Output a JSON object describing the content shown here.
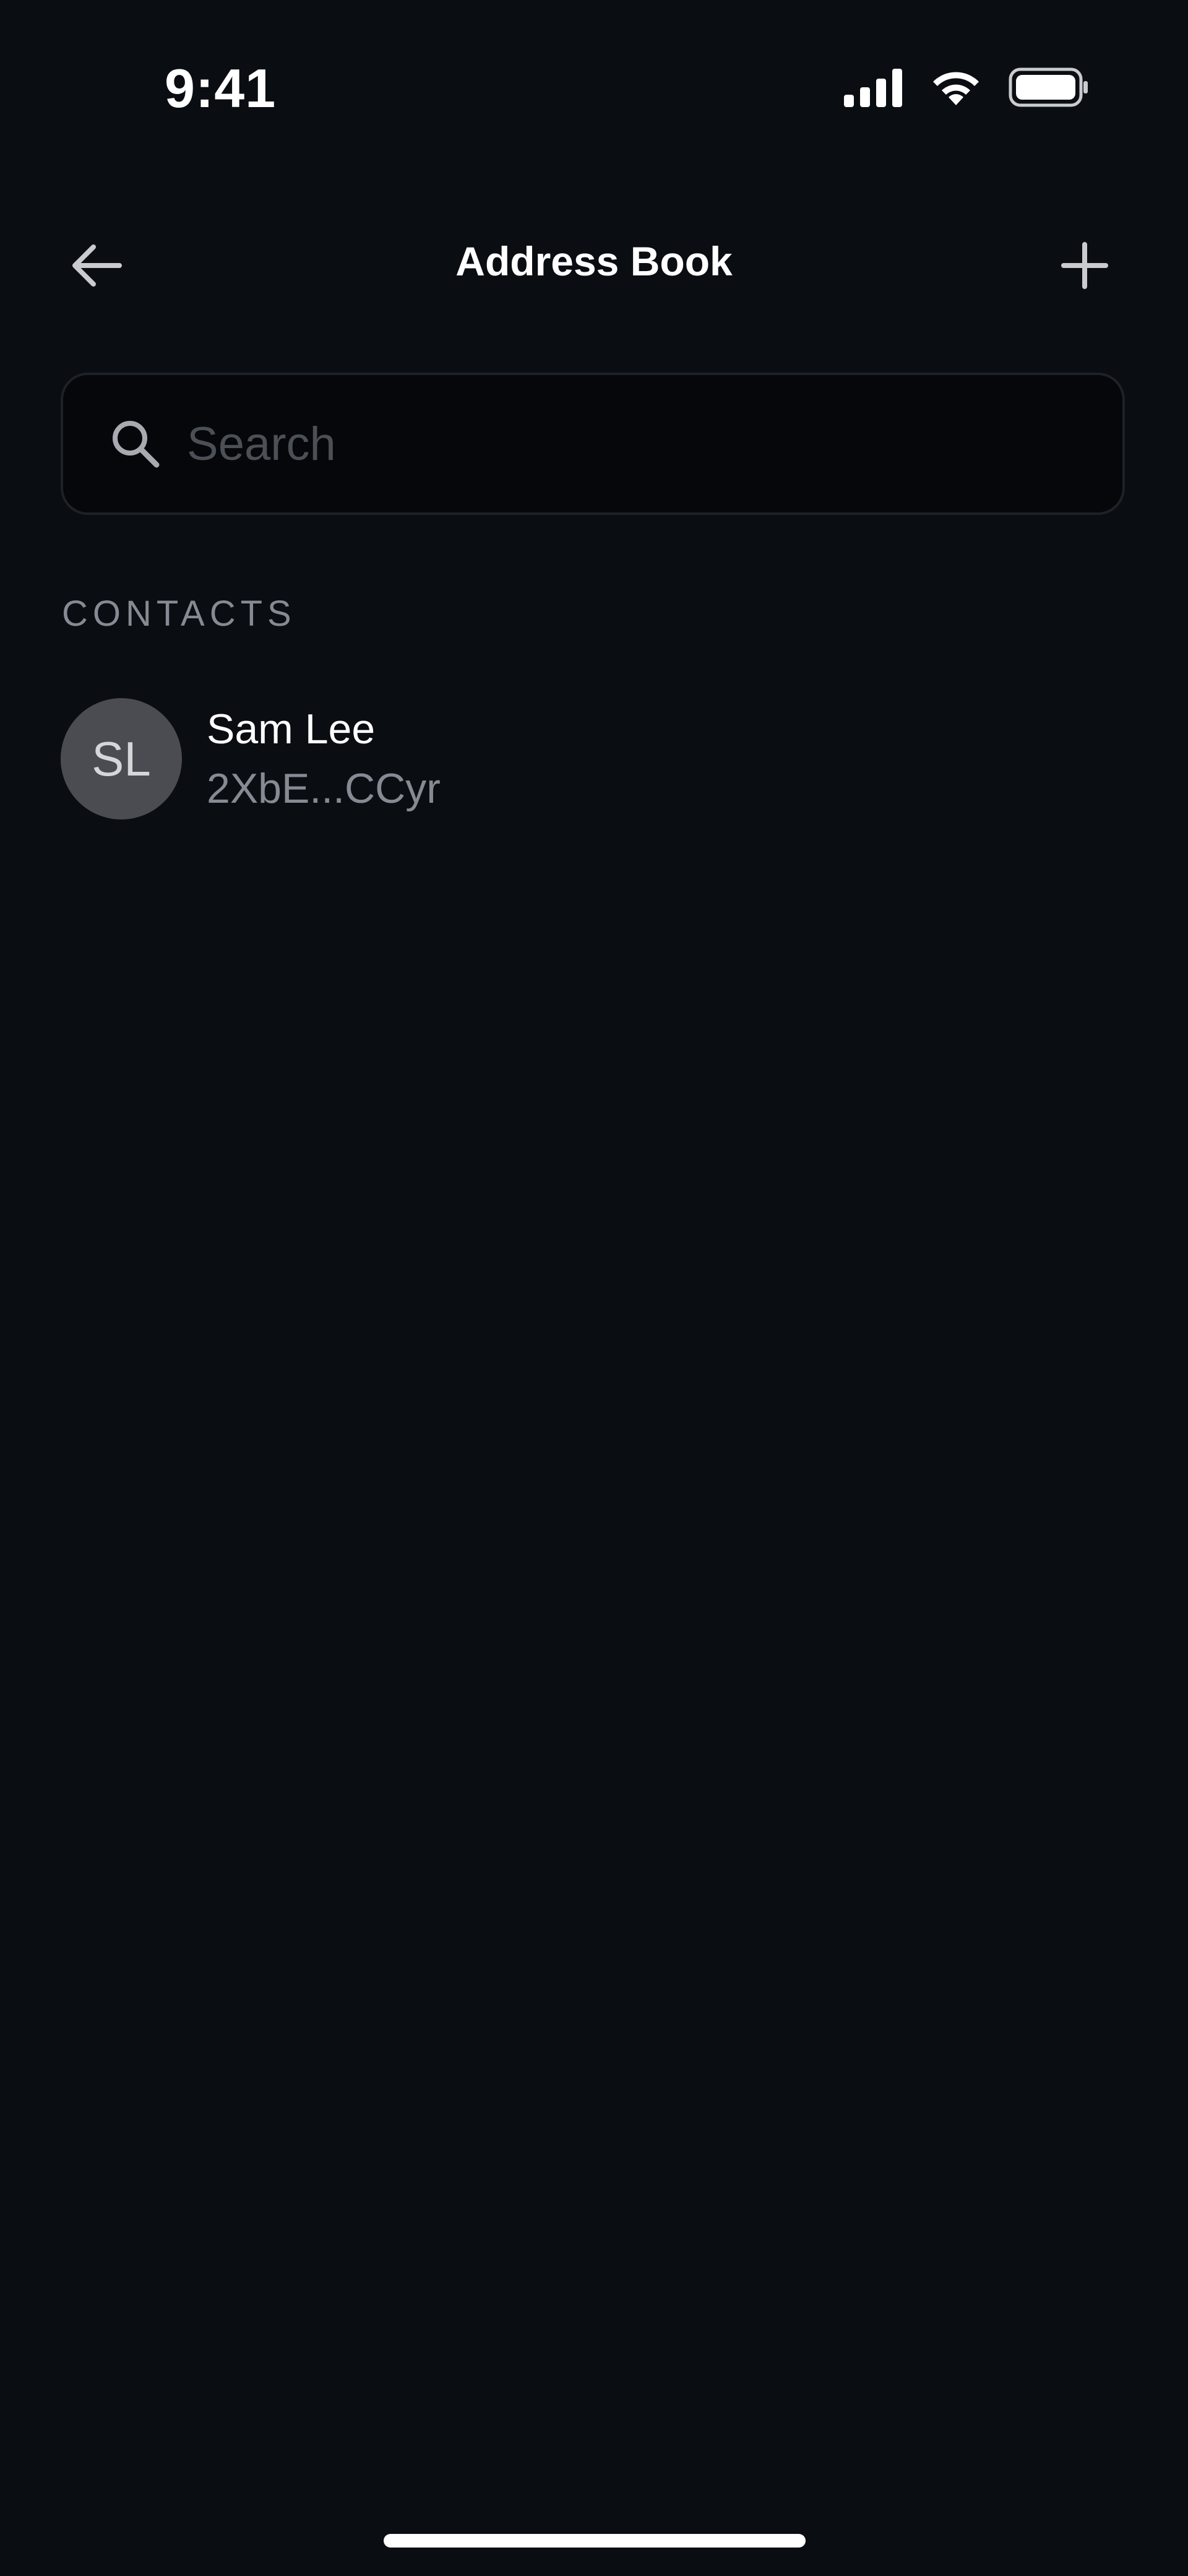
{
  "status_bar": {
    "time": "9:41",
    "icons": [
      "signal-icon",
      "wifi-icon",
      "battery-icon"
    ]
  },
  "header": {
    "title": "Address Book",
    "back_icon": "arrow-left-icon",
    "add_icon": "plus-icon"
  },
  "search": {
    "placeholder": "Search",
    "value": "",
    "icon": "search-icon"
  },
  "contacts": {
    "section_label": "CONTACTS",
    "items": [
      {
        "initials": "SL",
        "name": "Sam Lee",
        "address": "2XbE...CCyr"
      }
    ]
  },
  "colors": {
    "background": "#0a0d12",
    "search_background": "#05070a",
    "search_border": "#1e2228",
    "secondary_text": "#868a92",
    "avatar_background": "#4a4c51",
    "primary_text": "#ffffff"
  }
}
